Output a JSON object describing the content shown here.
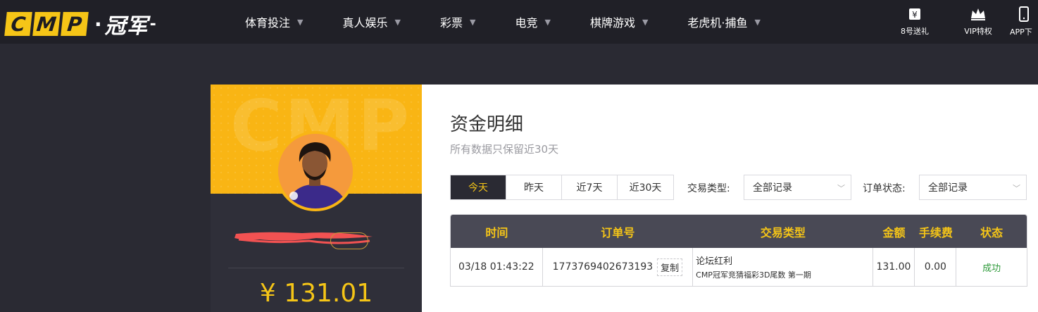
{
  "logo": {
    "letters": [
      "C",
      "M",
      "P"
    ],
    "dot": "·",
    "cn": "冠军",
    "tail": "-"
  },
  "nav": [
    {
      "label": "体育投注"
    },
    {
      "label": "真人娱乐"
    },
    {
      "label": "彩票"
    },
    {
      "label": "电竞"
    },
    {
      "label": "棋牌游戏"
    },
    {
      "label": "老虎机·捕鱼"
    }
  ],
  "tools": [
    {
      "label": "8号送礼",
      "icon": "gift-ticket-icon"
    },
    {
      "label": "VIP特权",
      "icon": "crown-icon"
    },
    {
      "label": "APP下",
      "icon": "phone-icon"
    }
  ],
  "profile": {
    "watermark": "CMP",
    "balance": "¥ 131.01"
  },
  "main": {
    "title": "资金明细",
    "subtitle": "所有数据只保留近30天",
    "date_tabs": [
      {
        "label": "今天",
        "active": true
      },
      {
        "label": "昨天",
        "active": false
      },
      {
        "label": "近7天",
        "active": false
      },
      {
        "label": "近30天",
        "active": false
      }
    ],
    "trade_type": {
      "label": "交易类型:",
      "value": "全部记录"
    },
    "order_status": {
      "label": "订单状态:",
      "value": "全部记录"
    },
    "table": {
      "headers": [
        "时间",
        "订单号",
        "交易类型",
        "金额",
        "手续费",
        "状态"
      ],
      "rows": [
        {
          "time": "03/18 01:43:22",
          "order_no": "1773769402673193",
          "copy_label": "复制",
          "type_main": "论坛红利",
          "type_desc": "CMP冠军竞猜福彩3D尾数 第一期",
          "amount": "131.00",
          "fee": "0.00",
          "status": "成功"
        }
      ]
    }
  },
  "colors": {
    "accent": "#f5c517",
    "banner": "#f9b514",
    "topbar": "#202027",
    "page_bg": "#2a2a33",
    "table_header": "#494955",
    "success": "#2e9a3a",
    "redact": "#f25252"
  }
}
